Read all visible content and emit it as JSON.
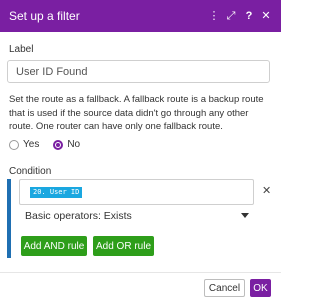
{
  "header": {
    "title": "Set up a filter",
    "kebab_icon": "⋮",
    "expand_icon": "⤢",
    "help_icon": "?",
    "close_icon": "✕"
  },
  "label_section": {
    "heading": "Label",
    "value": "User ID Found"
  },
  "fallback": {
    "description": "Set the route as a fallback. A fallback route is a backup route that is used if the source data didn't go through any other route. One router can have only one fallback route.",
    "options": [
      "Yes",
      "No"
    ],
    "selected": "No"
  },
  "condition": {
    "heading": "Condition",
    "token": "20. User ID",
    "operator": "Basic operators: Exists",
    "remove_icon": "✕"
  },
  "buttons": {
    "add_and": "Add AND rule",
    "add_or": "Add OR rule",
    "cancel": "Cancel",
    "ok": "OK"
  },
  "colors": {
    "header": "#7a1fa2",
    "accent": "#7a1fa2",
    "token": "#1aa7e0",
    "condition_bar": "#1f6fb2",
    "rule_buttons": "#2e9e1a"
  }
}
